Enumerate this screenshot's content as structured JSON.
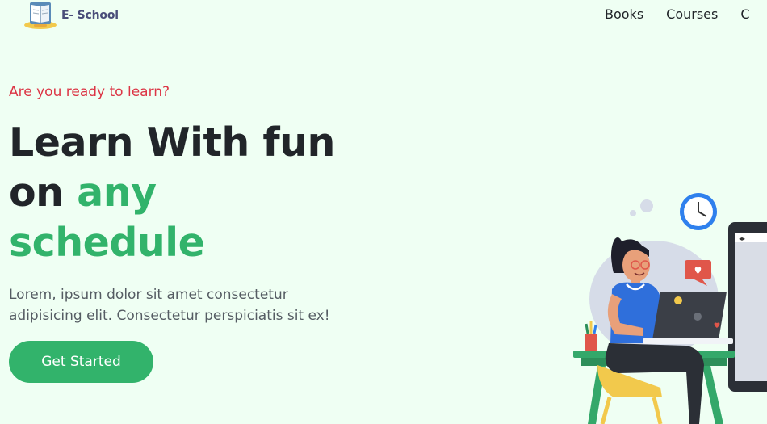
{
  "brand": {
    "name": "E- School"
  },
  "nav": {
    "items": [
      {
        "label": "Books"
      },
      {
        "label": "Courses"
      },
      {
        "label": "C"
      }
    ]
  },
  "hero": {
    "eyebrow": "Are you ready to learn?",
    "title_line1": "Learn With fun",
    "title_line2_plain": "on",
    "title_line2_accent": "any",
    "title_line3_accent": "schedule",
    "lead_line1": "Lorem, ipsum dolor sit amet consectetur",
    "lead_line2": "adipisicing elit. Consectetur perspiciatis sit ex!",
    "cta_label": "Get Started"
  },
  "colors": {
    "background": "#effff3",
    "accent": "#32b36b",
    "eyebrow": "#dc3545",
    "headline": "#212529",
    "body": "#555c63"
  },
  "icons": {
    "logo": "open-book-icon",
    "illustration": "student-at-laptop-illustration"
  }
}
